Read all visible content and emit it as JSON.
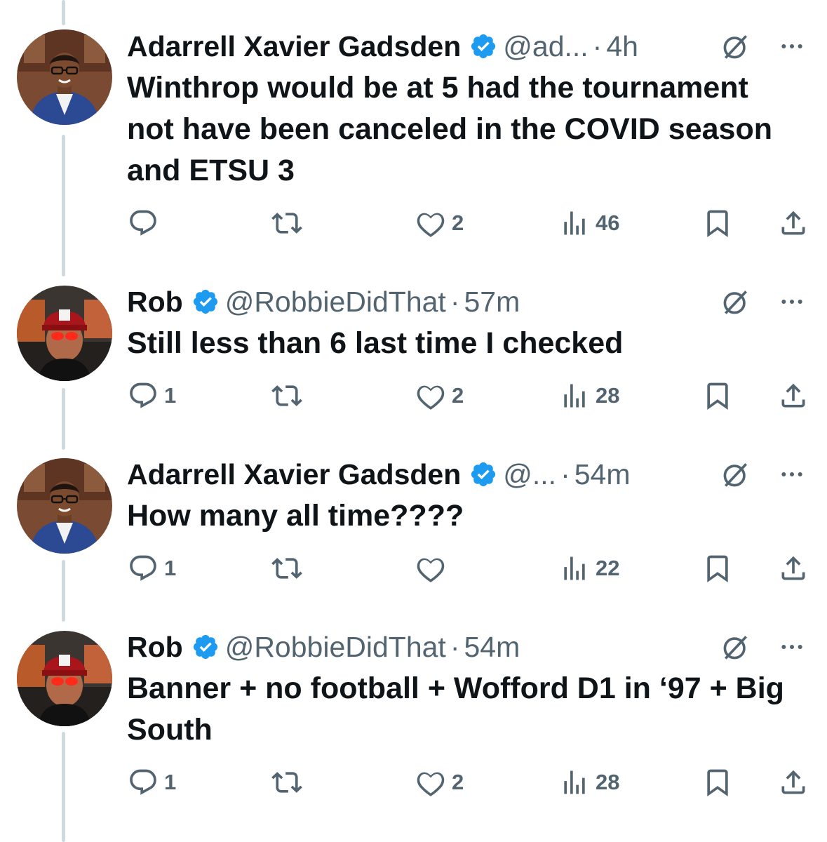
{
  "colors": {
    "text": "#0f1419",
    "muted": "#536471",
    "verified": "#1d9bf0",
    "thread_line": "#cfd9de"
  },
  "tweets": [
    {
      "name": "Adarrell Xavier Gadsden",
      "verified": true,
      "handle": "@ad...",
      "dot": "·",
      "time": "4h",
      "text": "Winthrop would be at 5 had the tournament not have been canceled in the COVID season and ETSU 3",
      "replies": "",
      "retweets": "",
      "likes": "2",
      "views": "46",
      "avatar": "man-in-suit-avatar"
    },
    {
      "name": "Rob",
      "verified": true,
      "handle": "@RobbieDidThat",
      "dot": "·",
      "time": "57m",
      "text": "Still less than 6 last time I checked",
      "replies": "1",
      "retweets": "",
      "likes": "2",
      "views": "28",
      "avatar": "red-cap-avatar"
    },
    {
      "name": "Adarrell Xavier Gadsden",
      "verified": true,
      "handle": "@...",
      "dot": "·",
      "time": "54m",
      "text": "How many all time????",
      "replies": "1",
      "retweets": "",
      "likes": "",
      "views": "22",
      "avatar": "man-in-suit-avatar"
    },
    {
      "name": "Rob",
      "verified": true,
      "handle": "@RobbieDidThat",
      "dot": "·",
      "time": "54m",
      "text": "Banner + no football + Wofford D1 in ‘97 + Big South",
      "replies": "1",
      "retweets": "",
      "likes": "2",
      "views": "28",
      "avatar": "red-cap-avatar"
    }
  ],
  "icons": {
    "reply": "speech-bubble-icon",
    "retweet": "retweet-arrows-icon",
    "like": "heart-outline-icon",
    "views": "bar-chart-icon",
    "bookmark": "bookmark-icon",
    "share": "share-upload-icon",
    "grok": "grok-slash-circle-icon",
    "more": "ellipsis-icon",
    "verified": "verified-badge-icon"
  }
}
